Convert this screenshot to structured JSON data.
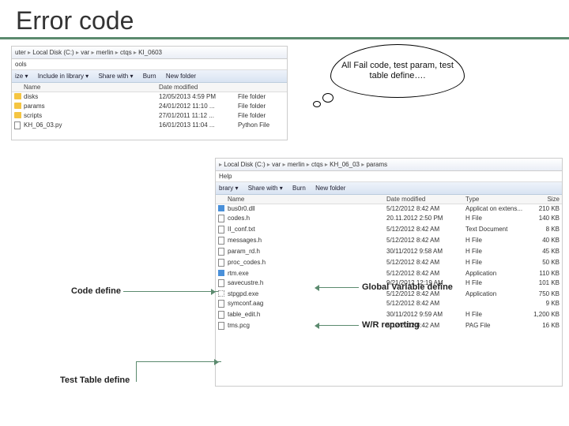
{
  "title": "Error code",
  "cloud_text": "All Fail code, test param, test table define….",
  "labels": {
    "code": "Code define",
    "global": "Global Variable define",
    "wr": "W/R reporting",
    "test": "Test Table define"
  },
  "exp_top": {
    "breadcrumb": [
      "uter",
      "Local Disk (C:)",
      "var",
      "merlin",
      "ctqs",
      "KI_0603"
    ],
    "menubar": "ools",
    "toolbar": [
      "ize ▾",
      "Include in library ▾",
      "Share with ▾",
      "Burn",
      "New folder"
    ],
    "cols": [
      "",
      "Name",
      "Date modified",
      ""
    ],
    "rows": [
      {
        "kind": "folder",
        "name": "disks",
        "date": "12/05/2013 4:59 PM",
        "type": "File folder"
      },
      {
        "kind": "folder",
        "name": "params",
        "date": "24/01/2012 11:10 ...",
        "type": "File folder"
      },
      {
        "kind": "folder",
        "name": "scripts",
        "date": "27/01/2011 11:12 ...",
        "type": "File folder"
      },
      {
        "kind": "file",
        "name": "KH_06_03.py",
        "date": "16/01/2013 11:04 ...",
        "type": "Python File"
      }
    ]
  },
  "exp_bot": {
    "breadcrumb": [
      "",
      "Local Disk (C:)",
      "var",
      "merlin",
      "ctqs",
      "KH_06_03",
      "params"
    ],
    "menubar": "Help",
    "toolbar": [
      "brary ▾",
      "Share with ▾",
      "Burn",
      "New folder"
    ],
    "cols": [
      "",
      "Name",
      "Date modified",
      "Type",
      "Size"
    ],
    "rows": [
      {
        "kind": "exe",
        "name": "bus0r0.dll",
        "date": "5/12/2012 8:42 AM",
        "type": "Applicat on extens...",
        "size": "210 KB"
      },
      {
        "kind": "file",
        "name": "codes.h",
        "date": "20.11.2012 2:50 PM",
        "type": "H File",
        "size": "140 KB"
      },
      {
        "kind": "file",
        "name": "II_conf.txt",
        "date": "5/12/2012 8:42 AM",
        "type": "Text Document",
        "size": "8 KB"
      },
      {
        "kind": "file",
        "name": "messages.h",
        "date": "5/12/2012 8:42 AM",
        "type": "H File",
        "size": "40 KB"
      },
      {
        "kind": "file",
        "name": "param_rd.h",
        "date": "30/11/2012 9:58 AM",
        "type": "H File",
        "size": "45 KB"
      },
      {
        "kind": "file",
        "name": "proc_codes.h",
        "date": "5/12/2012 8:42 AM",
        "type": "H File",
        "size": "50 KB"
      },
      {
        "kind": "exe",
        "name": "rtm.exe",
        "date": "5/12/2012 8:42 AM",
        "type": "Application",
        "size": "110 KB"
      },
      {
        "kind": "file",
        "name": "savecustre.h",
        "date": "9/21/2012 12:19 AM",
        "type": "H File",
        "size": "101 KB"
      },
      {
        "kind": "sel",
        "name": "stpgpd.exe",
        "date": "5/12/2012 8:42 AM",
        "type": "Application",
        "size": "750 KB"
      },
      {
        "kind": "file",
        "name": "symconf.aag",
        "date": "5/12/2012 8:42 AM",
        "type": "",
        "size": "9 KB"
      },
      {
        "kind": "file",
        "name": "table_edit.h",
        "date": "30/11/2012 9:59 AM",
        "type": "H File",
        "size": "1,200 KB"
      },
      {
        "kind": "file",
        "name": "tms.pcg",
        "date": "5/12/2012 8:42 AM",
        "type": "PAG File",
        "size": "16 KB"
      }
    ]
  }
}
